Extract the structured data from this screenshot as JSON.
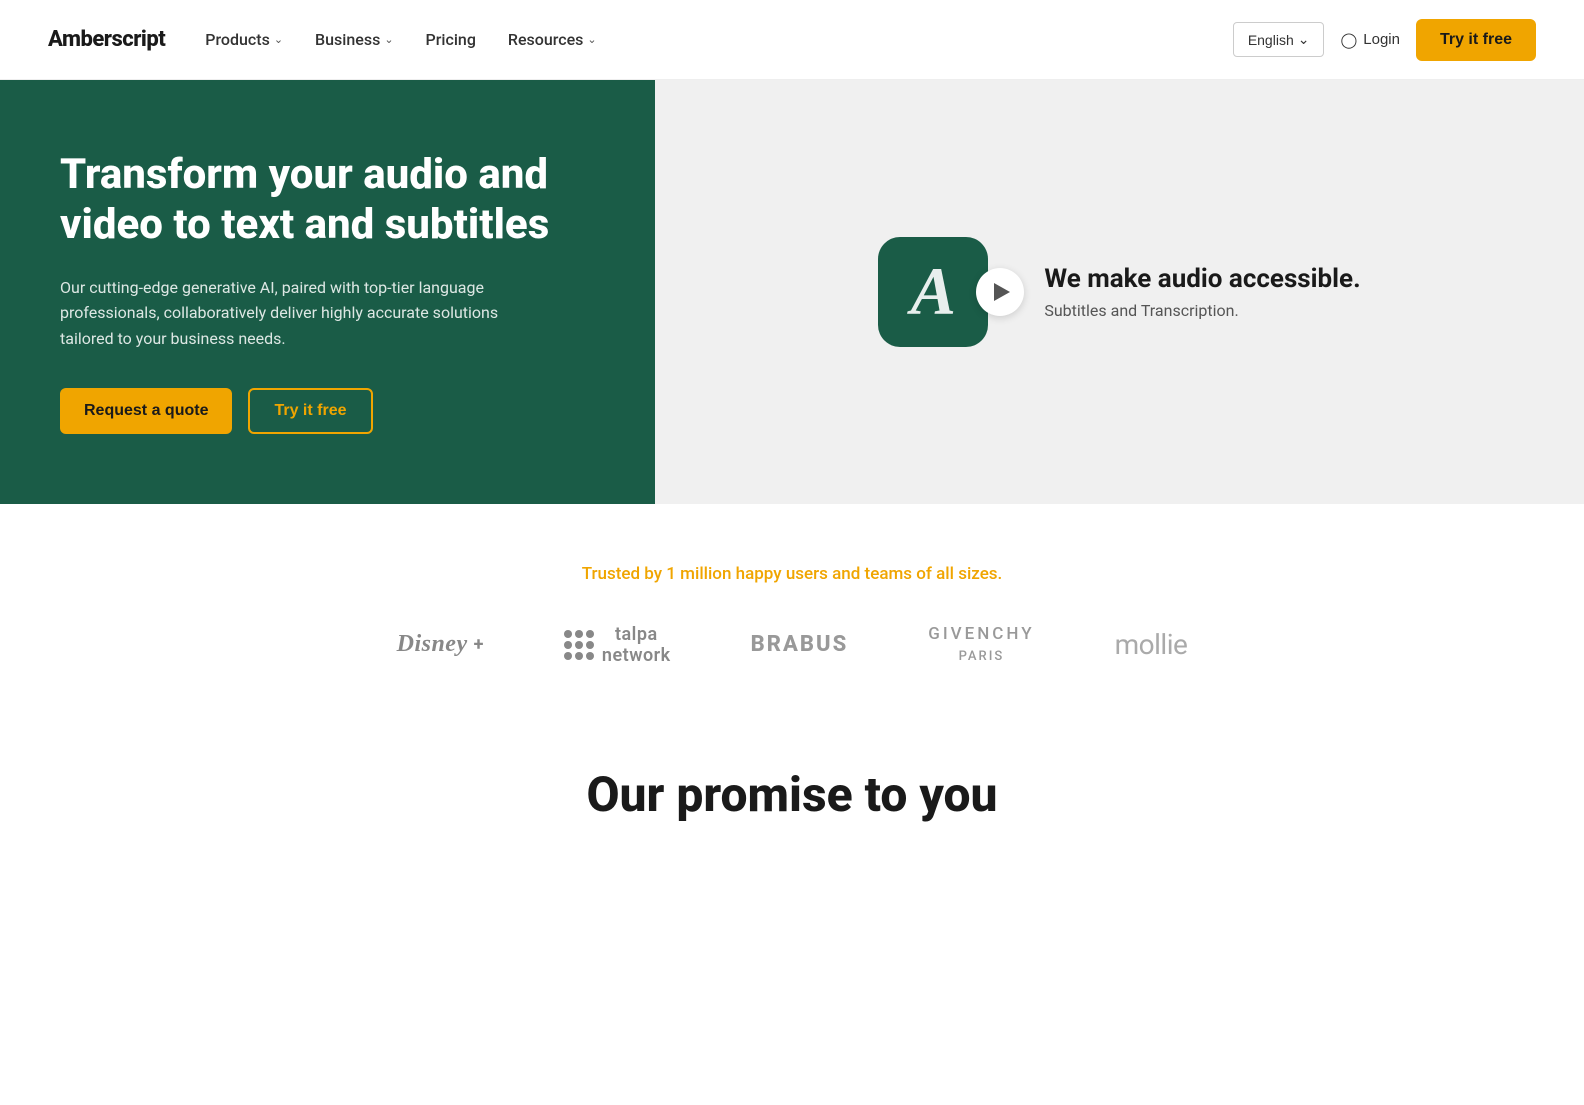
{
  "navbar": {
    "logo": "Amberscript",
    "nav_items": [
      {
        "label": "Products",
        "has_dropdown": true
      },
      {
        "label": "Business",
        "has_dropdown": true
      },
      {
        "label": "Pricing",
        "has_dropdown": false
      },
      {
        "label": "Resources",
        "has_dropdown": true
      }
    ],
    "language": "English",
    "login_label": "Login",
    "try_free_label": "Try it free"
  },
  "hero": {
    "title": "Transform your audio and video to text and subtitles",
    "subtitle": "Our cutting-edge generative AI, paired with top-tier language professionals, collaboratively deliver highly accurate solutions tailored to your business needs.",
    "btn_quote": "Request a quote",
    "btn_try": "Try it free",
    "tagline_main": "We make audio accessible.",
    "tagline_sub": "Subtitles and Transcription."
  },
  "trusted": {
    "label": "Trusted by 1 million happy users and teams of all sizes.",
    "logos": [
      {
        "name": "disney-plus",
        "display": "Disney+"
      },
      {
        "name": "talpa-network",
        "display": "talpa network"
      },
      {
        "name": "brabus",
        "display": "BRABUS"
      },
      {
        "name": "givenchy",
        "display": "GIVENCHY\nPARIS"
      },
      {
        "name": "mollie",
        "display": "mollie"
      }
    ]
  },
  "promise": {
    "title": "Our promise to you"
  }
}
